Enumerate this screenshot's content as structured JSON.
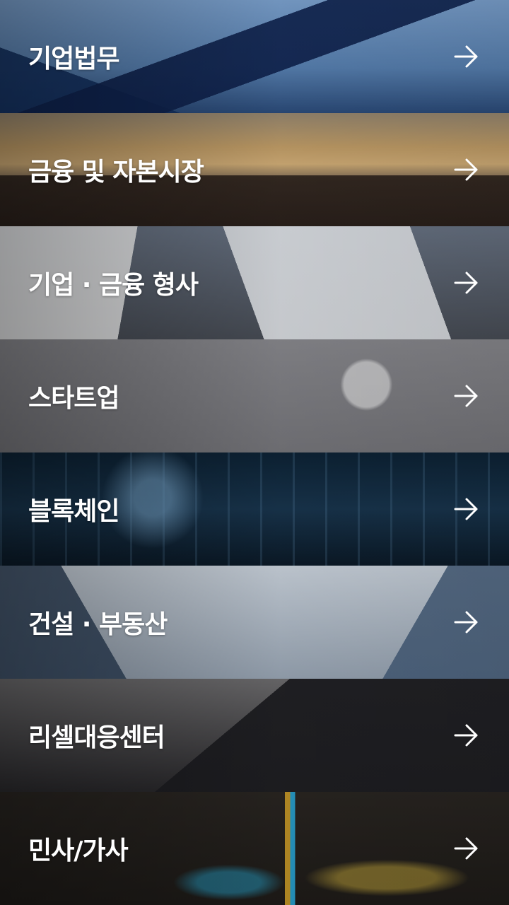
{
  "menu": {
    "items": [
      {
        "label": "기업법무",
        "arrow_icon": "arrow-right-icon"
      },
      {
        "label": "금융 및 자본시장",
        "arrow_icon": "arrow-right-icon"
      },
      {
        "label": "기업 · 금융 형사",
        "arrow_icon": "arrow-right-icon"
      },
      {
        "label": "스타트업",
        "arrow_icon": "arrow-right-icon"
      },
      {
        "label": "블록체인",
        "arrow_icon": "arrow-right-icon"
      },
      {
        "label": "건설 · 부동산",
        "arrow_icon": "arrow-right-icon"
      },
      {
        "label": "리셀대응센터",
        "arrow_icon": "arrow-right-icon"
      },
      {
        "label": "민사/가사",
        "arrow_icon": "arrow-right-icon"
      }
    ]
  },
  "colors": {
    "label_text": "#ffffff",
    "arrow": "#ffffff"
  }
}
